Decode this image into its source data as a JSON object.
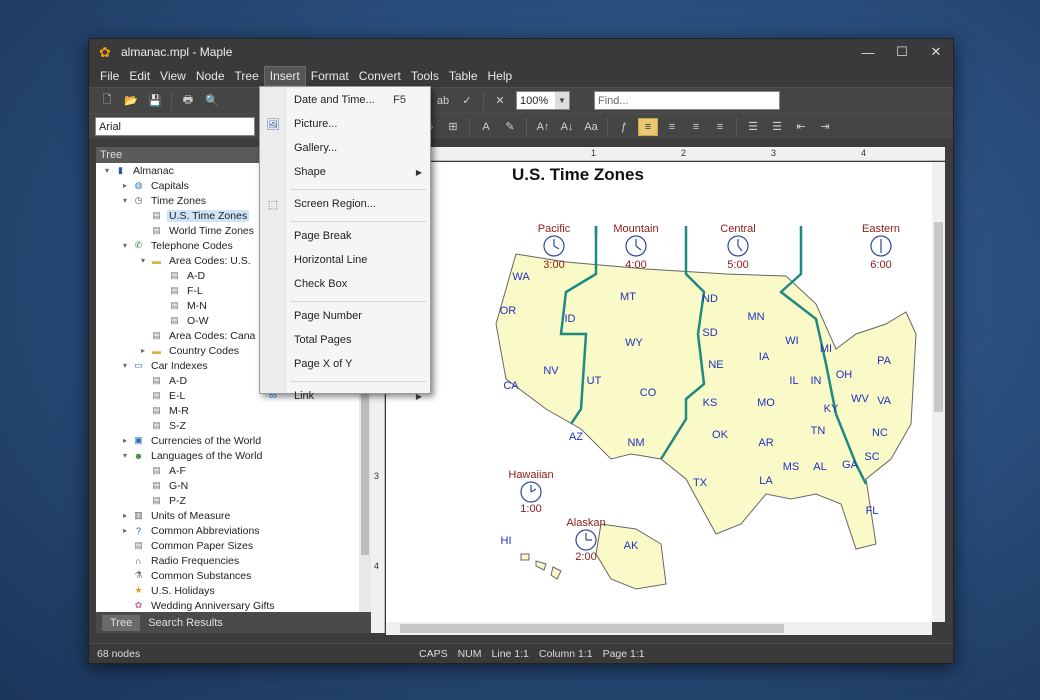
{
  "window": {
    "title": "almanac.mpl - Maple"
  },
  "menubar": [
    "File",
    "Edit",
    "View",
    "Node",
    "Tree",
    "Insert",
    "Format",
    "Convert",
    "Tools",
    "Table",
    "Help"
  ],
  "toolbar": {
    "zoom": "100%",
    "find_placeholder": "Find..."
  },
  "format_bar": {
    "font": "Arial"
  },
  "tree_panel": {
    "header": "Tree",
    "items": [
      {
        "label": "Almanac",
        "level": 0,
        "toggle": "expanded",
        "icon": "book-icon"
      },
      {
        "label": "Capitals",
        "level": 1,
        "toggle": "collapsed",
        "icon": "globe-icon"
      },
      {
        "label": "Time Zones",
        "level": 1,
        "toggle": "expanded",
        "icon": "clock-icon"
      },
      {
        "label": "U.S. Time Zones",
        "level": 2,
        "toggle": "none",
        "icon": "page-icon",
        "selected": true
      },
      {
        "label": "World Time Zones",
        "level": 2,
        "toggle": "none",
        "icon": "page-icon"
      },
      {
        "label": "Telephone Codes",
        "level": 1,
        "toggle": "expanded",
        "icon": "phone-icon"
      },
      {
        "label": "Area Codes: U.S.",
        "level": 2,
        "toggle": "expanded",
        "icon": "folder-icon"
      },
      {
        "label": "A-D",
        "level": 3,
        "toggle": "none",
        "icon": "page-icon"
      },
      {
        "label": "F-L",
        "level": 3,
        "toggle": "none",
        "icon": "page-icon"
      },
      {
        "label": "M-N",
        "level": 3,
        "toggle": "none",
        "icon": "page-icon"
      },
      {
        "label": "O-W",
        "level": 3,
        "toggle": "none",
        "icon": "page-icon"
      },
      {
        "label": "Area Codes: Cana",
        "level": 2,
        "toggle": "none",
        "icon": "page-icon"
      },
      {
        "label": "Country Codes",
        "level": 2,
        "toggle": "collapsed",
        "icon": "folder-icon"
      },
      {
        "label": "Car Indexes",
        "level": 1,
        "toggle": "expanded",
        "icon": "car-icon"
      },
      {
        "label": "A-D",
        "level": 2,
        "toggle": "none",
        "icon": "page-icon"
      },
      {
        "label": "E-L",
        "level": 2,
        "toggle": "none",
        "icon": "page-icon"
      },
      {
        "label": "M-R",
        "level": 2,
        "toggle": "none",
        "icon": "page-icon"
      },
      {
        "label": "S-Z",
        "level": 2,
        "toggle": "none",
        "icon": "page-icon"
      },
      {
        "label": "Currencies of the World",
        "level": 1,
        "toggle": "collapsed",
        "icon": "money-icon"
      },
      {
        "label": "Languages of the World",
        "level": 1,
        "toggle": "expanded",
        "icon": "person-icon"
      },
      {
        "label": "A-F",
        "level": 2,
        "toggle": "none",
        "icon": "page-icon"
      },
      {
        "label": "G-N",
        "level": 2,
        "toggle": "none",
        "icon": "page-icon"
      },
      {
        "label": "P-Z",
        "level": 2,
        "toggle": "none",
        "icon": "page-icon"
      },
      {
        "label": "Units of Measure",
        "level": 1,
        "toggle": "collapsed",
        "icon": "ruler-icon"
      },
      {
        "label": "Common Abbreviations",
        "level": 1,
        "toggle": "collapsed",
        "icon": "question-icon"
      },
      {
        "label": "Common Paper Sizes",
        "level": 1,
        "toggle": "none",
        "icon": "page-icon"
      },
      {
        "label": "Radio Frequencies",
        "level": 1,
        "toggle": "none",
        "icon": "headphones-icon"
      },
      {
        "label": "Common Substances",
        "level": 1,
        "toggle": "none",
        "icon": "flask-icon"
      },
      {
        "label": "U.S. Holidays",
        "level": 1,
        "toggle": "none",
        "icon": "star-icon"
      },
      {
        "label": "Wedding Anniversary Gifts",
        "level": 1,
        "toggle": "none",
        "icon": "flower-icon"
      }
    ],
    "tabs": [
      "Tree",
      "Search Results"
    ]
  },
  "insert_menu": {
    "items": [
      {
        "label": "Date and Time...",
        "shortcut": "F5",
        "icon": ""
      },
      {
        "label": "Picture...",
        "shortcut": "",
        "icon": "picture-icon"
      },
      {
        "label": "Gallery...",
        "shortcut": "",
        "icon": ""
      },
      {
        "label": "Shape",
        "shortcut": "",
        "icon": "",
        "submenu": true
      },
      {
        "label": "Screen Region...",
        "shortcut": "",
        "icon": "screen-region-icon",
        "sep_before": true
      },
      {
        "label": "Page Break",
        "shortcut": "",
        "icon": "",
        "sep_before": true
      },
      {
        "label": "Horizontal Line",
        "shortcut": "",
        "icon": ""
      },
      {
        "label": "Check Box",
        "shortcut": "",
        "icon": ""
      },
      {
        "label": "Page Number",
        "shortcut": "",
        "icon": "",
        "sep_before": true
      },
      {
        "label": "Total Pages",
        "shortcut": "",
        "icon": ""
      },
      {
        "label": "Page X of Y",
        "shortcut": "",
        "icon": ""
      },
      {
        "label": "Link",
        "shortcut": "",
        "icon": "link-icon",
        "submenu": true,
        "sep_before": true
      }
    ]
  },
  "document": {
    "title": "U.S. Time Zones",
    "zones": [
      {
        "name": "Pacific",
        "time": "3:00"
      },
      {
        "name": "Mountain",
        "time": "4:00"
      },
      {
        "name": "Central",
        "time": "5:00"
      },
      {
        "name": "Eastern",
        "time": "6:00"
      },
      {
        "name": "Hawaiian",
        "time": "1:00"
      },
      {
        "name": "Alaskan",
        "time": "2:00"
      }
    ],
    "states": [
      "WA",
      "OR",
      "ID",
      "MT",
      "ND",
      "MN",
      "SD",
      "WI",
      "MI",
      "CA",
      "NV",
      "UT",
      "WY",
      "NE",
      "IA",
      "IL",
      "IN",
      "OH",
      "PA",
      "CO",
      "KS",
      "MO",
      "KY",
      "WV",
      "VA",
      "AZ",
      "NM",
      "OK",
      "AR",
      "TN",
      "NC",
      "SC",
      "TX",
      "LA",
      "MS",
      "AL",
      "GA",
      "FL",
      "AK",
      "HI"
    ]
  },
  "ruler": {
    "h_ticks": [
      "1",
      "2",
      "3",
      "4"
    ],
    "v_ticks": [
      "2",
      "3",
      "4"
    ]
  },
  "statusbar": {
    "nodes": "68 nodes",
    "caps": "CAPS",
    "num": "NUM",
    "line": "Line 1:1",
    "column": "Column 1:1",
    "page": "Page 1:1"
  }
}
